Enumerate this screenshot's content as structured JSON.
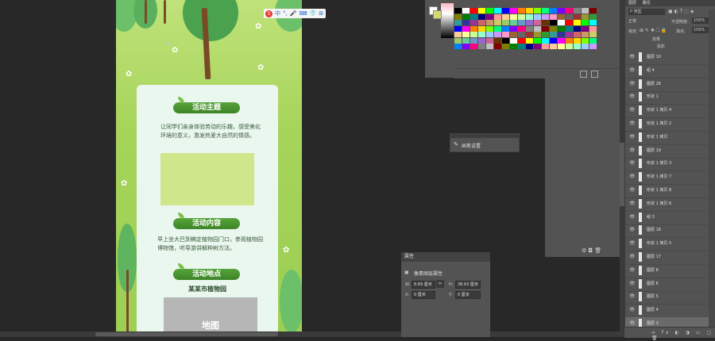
{
  "document": {
    "sections": [
      {
        "heading": "活动主题",
        "body": "让同学们亲身体验劳动的乐趣，感受美化环境的意义，激发热爱大自然的情感。"
      },
      {
        "heading": "活动内容",
        "body": "早上坐大巴到稿定植物园门口，参观植物园博物馆，听导游讲解种树方法。"
      },
      {
        "heading": "活动地点",
        "body": "某某市植物园"
      }
    ],
    "map_label": "地图"
  },
  "ime": {
    "logo": "S",
    "items": [
      "中",
      "°,",
      "🎤",
      "⌨",
      "👕",
      "⊞"
    ]
  },
  "swatch_colors": [
    "#000000",
    "#ffffff",
    "#ff0000",
    "#ffff00",
    "#00ff00",
    "#00ffff",
    "#0000ff",
    "#ff00ff",
    "#ff7f00",
    "#ffd700",
    "#7fff00",
    "#00ff7f",
    "#007fff",
    "#7f00ff",
    "#ff007f",
    "#808080",
    "#c0c0c0",
    "#800000",
    "#808000",
    "#008000",
    "#008080",
    "#000080",
    "#800080",
    "#ff9999",
    "#ffcc99",
    "#ffff99",
    "#ccff99",
    "#99ffcc",
    "#99ccff",
    "#cc99ff",
    "#ff99cc",
    "#996633",
    "#666666",
    "#993333",
    "#999933",
    "#339933",
    "#339999",
    "#333399",
    "#993399",
    "#cc6666",
    "#cc9966",
    "#cccc66",
    "#99cc66",
    "#66cc99",
    "#6699cc",
    "#9966cc",
    "#cc6699",
    "#663300"
  ],
  "brush_panel": {
    "label": "画笔设置"
  },
  "properties": {
    "tab": "属性",
    "type_label": "像素图层属性",
    "w_label": "W:",
    "w_value": "8.89 厘米",
    "h_label": "H:",
    "h_value": "38.63 厘米",
    "x_label": "X:",
    "x_value": "0 厘米",
    "y_label": "Y:",
    "y_value": "0 厘米"
  },
  "layers_panel": {
    "tabs": [
      "图层",
      "路径"
    ],
    "filter_label": "P 类型",
    "blend_mode": "正常",
    "opacity_label": "不透明度:",
    "opacity_value": "100%",
    "lock_label": "锁定:",
    "fill_label": "填充:",
    "fill_value": "100%",
    "effects_label": "效果",
    "shadow_label": "投影",
    "layers": [
      {
        "name": "图层 10"
      },
      {
        "name": "组 4"
      },
      {
        "name": "图层 26"
      },
      {
        "name": "形状 1"
      },
      {
        "name": "形状 1 拷贝 4"
      },
      {
        "name": "形状 1 拷贝 2"
      },
      {
        "name": "形状 1 拷贝"
      },
      {
        "name": "图层 19"
      },
      {
        "name": "形状 1 拷贝 3"
      },
      {
        "name": "形状 1 拷贝 7"
      },
      {
        "name": "形状 1 拷贝 8"
      },
      {
        "name": "形状 1 拷贝 6"
      },
      {
        "name": "组 3"
      },
      {
        "name": "图层 18"
      },
      {
        "name": "形状 1 拷贝 5"
      },
      {
        "name": "图层 17"
      },
      {
        "name": "图层 8"
      },
      {
        "name": "图层 6"
      },
      {
        "name": "图层 5"
      },
      {
        "name": "图层 4"
      },
      {
        "name": "图层 3"
      }
    ]
  }
}
